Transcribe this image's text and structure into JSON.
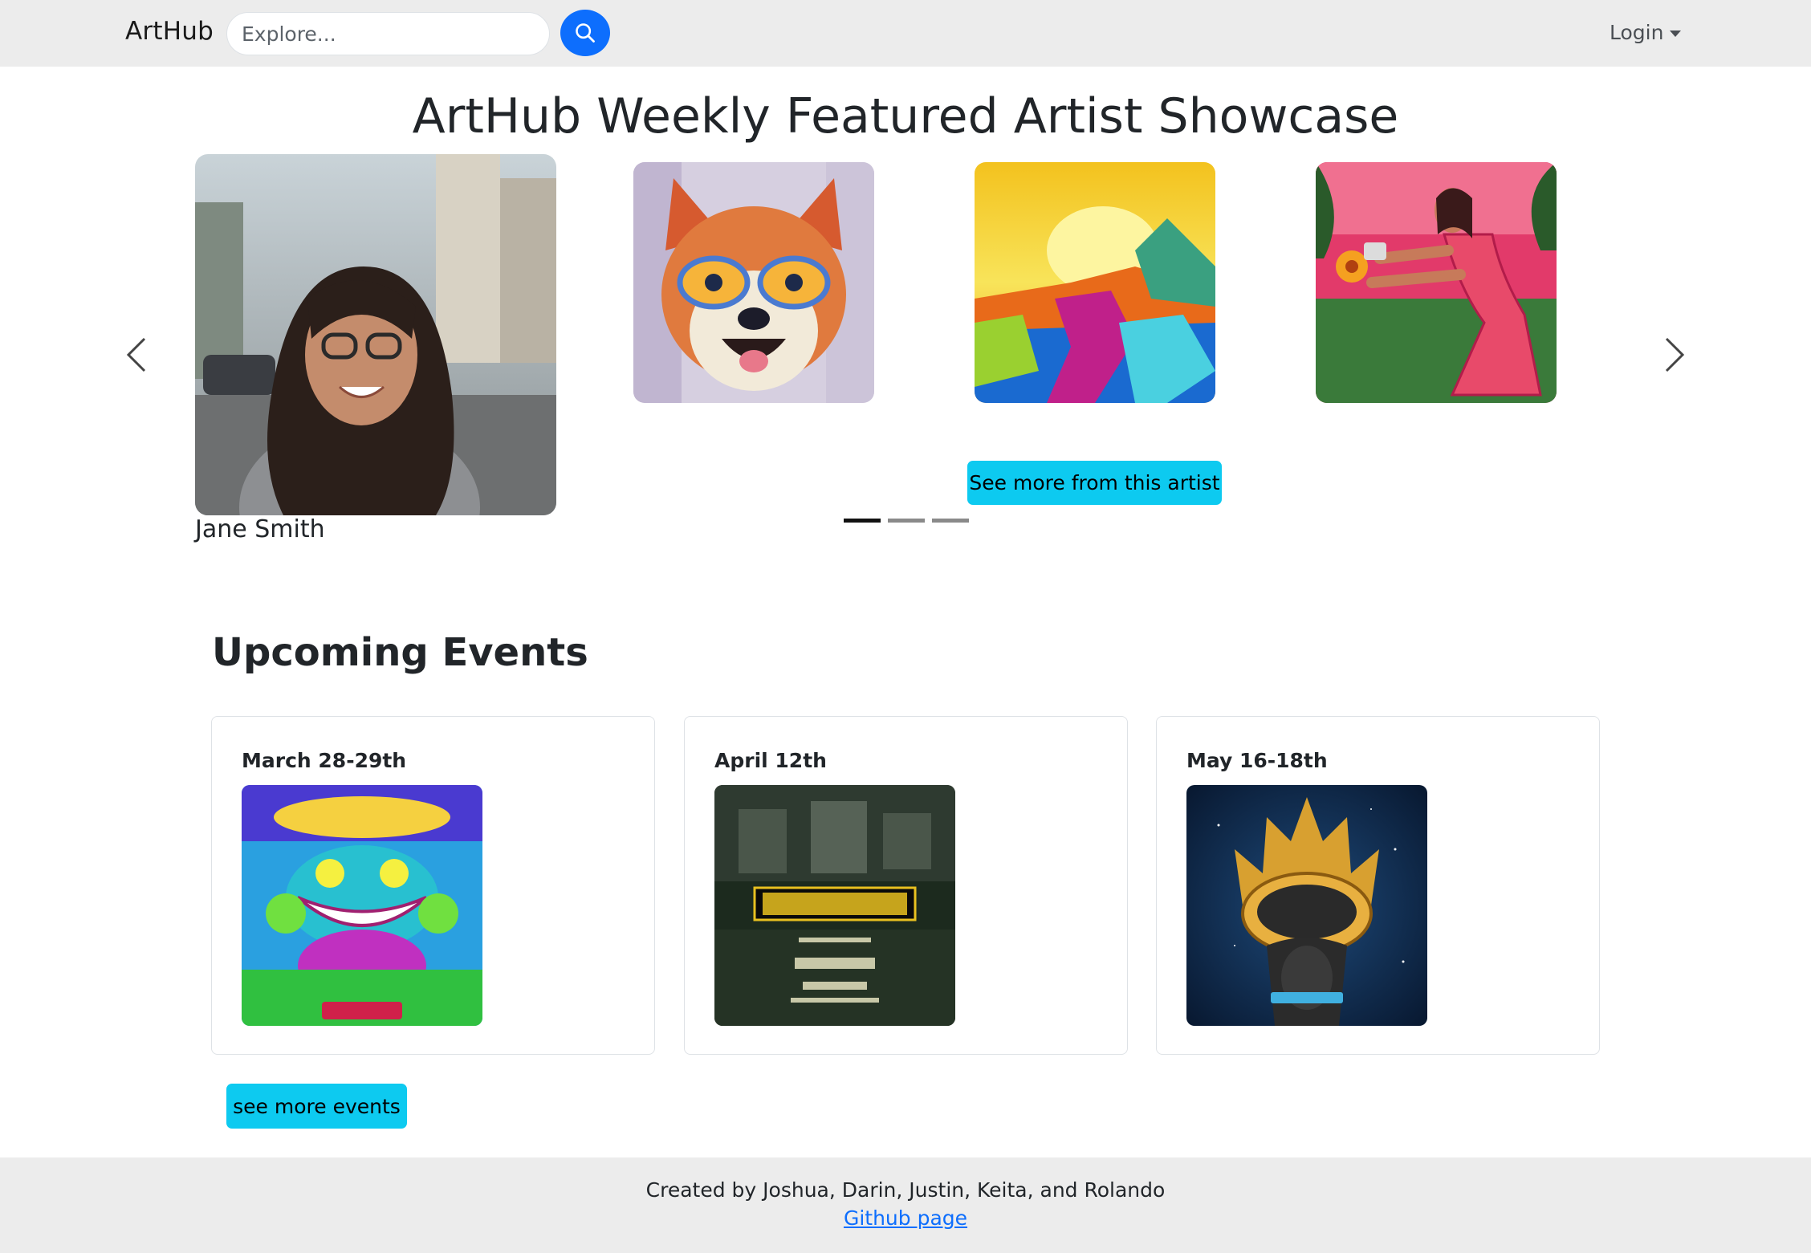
{
  "navbar": {
    "brand": "ArtHub",
    "search_placeholder": "Explore...",
    "search_icon": "search-icon",
    "login_label": "Login"
  },
  "showcase": {
    "title": "ArtHub Weekly Featured Artist Showcase",
    "artist_name": "Jane Smith",
    "see_more_label": "See more from this artist",
    "artworks": [
      "shiba-dog-painting",
      "abstract-landscape-painting",
      "woman-garden-painting"
    ],
    "indicators": {
      "count": 3,
      "active": 0
    },
    "prev_icon": "chevron-left-icon",
    "next_icon": "chevron-right-icon"
  },
  "events": {
    "title": "Upcoming Events",
    "items": [
      {
        "date": "March 28-29th",
        "poster": "beyond-wonderland-poster"
      },
      {
        "date": "April 12th",
        "poster": "get-cranked-poster"
      },
      {
        "date": "May 16-18th",
        "poster": "edc-las-vegas-poster"
      }
    ],
    "see_more_label": "see more events"
  },
  "footer": {
    "credit": "Created by Joshua, Darin, Justin, Keita, and Rolando",
    "link_label": "Github page"
  },
  "colors": {
    "primary": "#0d6efd",
    "info": "#0dcaf0",
    "navbar_bg": "#ececec"
  }
}
